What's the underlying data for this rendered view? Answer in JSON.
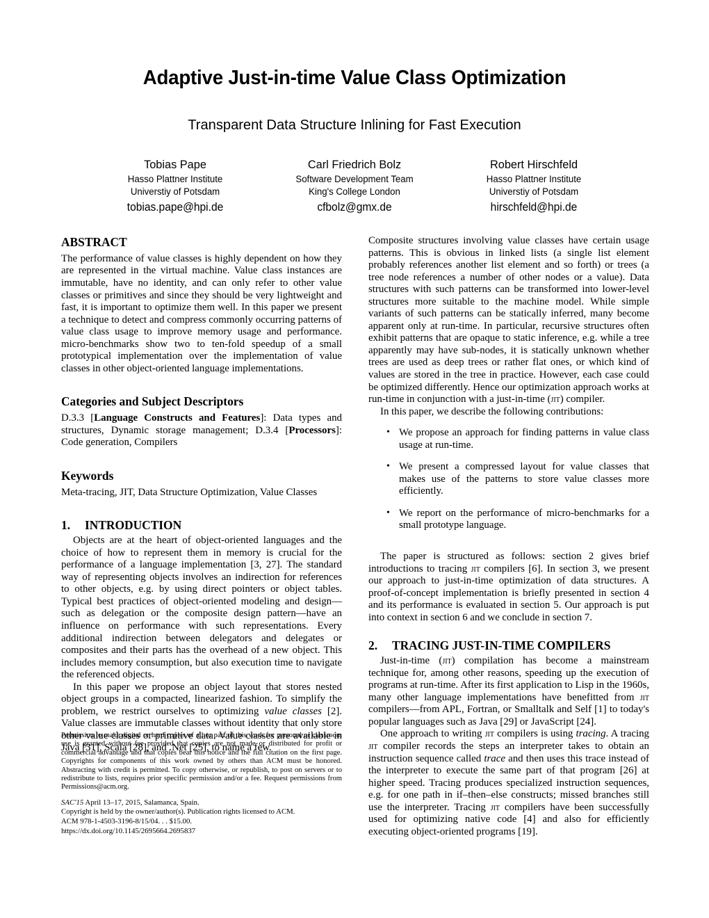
{
  "paper": {
    "title": "Adaptive Just-in-time Value Class Optimization",
    "subtitle": "Transparent Data Structure Inlining for Fast Execution",
    "authors": [
      {
        "name": "Tobias Pape",
        "affiliation_line1": "Hasso Plattner Institute",
        "affiliation_line2": "Universtiy of Potsdam",
        "email": "tobias.pape@hpi.de"
      },
      {
        "name": "Carl Friedrich Bolz",
        "affiliation_line1": "Software Development Team",
        "affiliation_line2": "King's College London",
        "email": "cfbolz@gmx.de"
      },
      {
        "name": "Robert Hirschfeld",
        "affiliation_line1": "Hasso Plattner Institute",
        "affiliation_line2": "Universtiy of Potsdam",
        "email": "hirschfeld@hpi.de"
      }
    ]
  },
  "abstract": {
    "heading": "ABSTRACT",
    "text": "The performance of value classes is highly dependent on how they are represented in the virtual machine. Value class instances are immutable, have no identity, and can only refer to other value classes or primitives and since they should be very lightweight and fast, it is important to optimize them well. In this paper we present a technique to detect and compress commonly occurring patterns of value class usage to improve memory usage and performance. micro-benchmarks show two to ten-fold speedup of a small prototypical implementation over the implementation of value classes in other object-oriented language implementations."
  },
  "categories": {
    "heading": "Categories and Subject Descriptors",
    "code1": "D.3.3 [",
    "bold1": "Language Constructs and Features",
    "mid1": "]: Data types and structures, Dynamic storage management; D.3.4 [",
    "bold2": "Processors",
    "tail": "]: Code generation, Compilers"
  },
  "keywords": {
    "heading": "Keywords",
    "text": "Meta-tracing, JIT, Data Structure Optimization, Value Classes"
  },
  "introduction": {
    "number": "1.",
    "heading": "INTRODUCTION",
    "para1": "Objects are at the heart of object-oriented languages and the choice of how to represent them in memory is crucial for the performance of a language implementation [3, 27]. The standard way of representing objects involves an indirection for references to other objects, e.g. by using direct pointers or object tables. Typical best practices of object-oriented modeling and design—such as delegation or the composite design pattern—have an influence on performance with such representations. Every additional indirection between delegators and delegates or composites and their parts has the overhead of a new object. This includes memory consumption, but also execution time to navigate the referenced objects.",
    "para2_a": "In this paper we propose an object layout that stores nested object groups in a compacted, linearized fashion. To simplify the problem, we restrict ourselves to optimizing ",
    "para2_italic": "value classes",
    "para2_b": " [2]. Value classes are immutable classes without identity that only store other value classes or primitive data. Value classes are available in Java [31], Scala [28], and .Net [25], to name a few.",
    "para3_a": "Composite structures involving value classes have certain usage patterns. This is obvious in linked lists (a single list element probably references another list element and so forth) or trees (a tree node references a number of other nodes or a value). Data structures with such patterns can be transformed into lower-level structures more suitable to the machine model. While simple variants of such patterns can be statically inferred, many become apparent only at run-time. In particular, recursive structures often exhibit patterns that are opaque to static inference, e.g. while a tree apparently may have sub-nodes, it is statically unknown whether trees are used as deep trees or rather flat ones, or which kind of values are stored in the tree in practice. However, each case could be optimized differently. Hence our optimization approach works at run-time in conjunction with a just-in-time (",
    "para3_sc": "jit",
    "para3_b": ") compiler.",
    "para4": "In this paper, we describe the following contributions:",
    "contributions": [
      "We propose an approach for finding patterns in value class usage at run-time.",
      "We present a compressed layout for value classes that makes use of the patterns to store value classes more efficiently.",
      "We report on the performance of micro-benchmarks for a small prototype language."
    ],
    "structure_a": "The paper is structured as follows: section 2 gives brief introductions to tracing ",
    "structure_sc": "jit",
    "structure_b": " compilers [6]. In section 3, we present our approach to just-in-time optimization of data structures. A proof-of-concept implementation is briefly presented in section 4 and its performance is evaluated in section 5. Our approach is put into context in section 6 and we conclude in section 7."
  },
  "section2": {
    "number": "2.",
    "heading": "TRACING JUST-IN-TIME COMPILERS",
    "para1_a": "Just-in-time (",
    "para1_sc1": "jit",
    "para1_b": ") compilation has become a mainstream technique for, among other reasons, speeding up the execution of programs at run-time. After its first application to Lisp in the 1960s, many other language implementations have benefitted from ",
    "para1_sc2": "jit",
    "para1_c": " compilers—from APL, Fortran, or Smalltalk and Self [1] to today's popular languages such as Java [29] or JavaScript [24].",
    "para2_a": "One approach to writing ",
    "para2_sc1": "jit",
    "para2_b": " compilers is using ",
    "para2_it1": "tracing",
    "para2_c": ". A tracing ",
    "para2_sc2": "jit",
    "para2_d": " compiler records the steps an interpreter takes to obtain an instruction sequence called ",
    "para2_it2": "trace",
    "para2_e": " and then uses this trace instead of the interpreter to execute the same part of that program [26] at higher speed. Tracing produces specialized instruction sequences, e.g. for one path in if–then–else constructs; missed branches still use the interpreter. Tracing ",
    "para2_sc3": "jit",
    "para2_f": " compilers have been successfully used for optimizing native code [4] and also for efficiently executing object-oriented programs [19]."
  },
  "copyright": {
    "permission": "Permission to make digital or hard copies of all or part of this work for personal or classroom use is granted without fee provided that copies are not made or distributed for profit or commercial advantage and that copies bear this notice and the full citation on the first page. Copyrights for components of this work owned by others than ACM must be honored. Abstracting with credit is permitted. To copy otherwise, or republish, to post on servers or to redistribute to lists, requires prior specific permission and/or a fee. Request permissions from Permissions@acm.org.",
    "conference_italic": "SAC'15",
    "conference_rest": " April 13–17, 2015, Salamanca, Spain.",
    "license": "Copyright is held by the owner/author(s). Publication rights licensed to ACM.",
    "isbn": "ACM 978-1-4503-3196-8/15/04. . . $15.00.",
    "doi": "https://dx.doi.org/10.1145/2695664.2695837"
  }
}
